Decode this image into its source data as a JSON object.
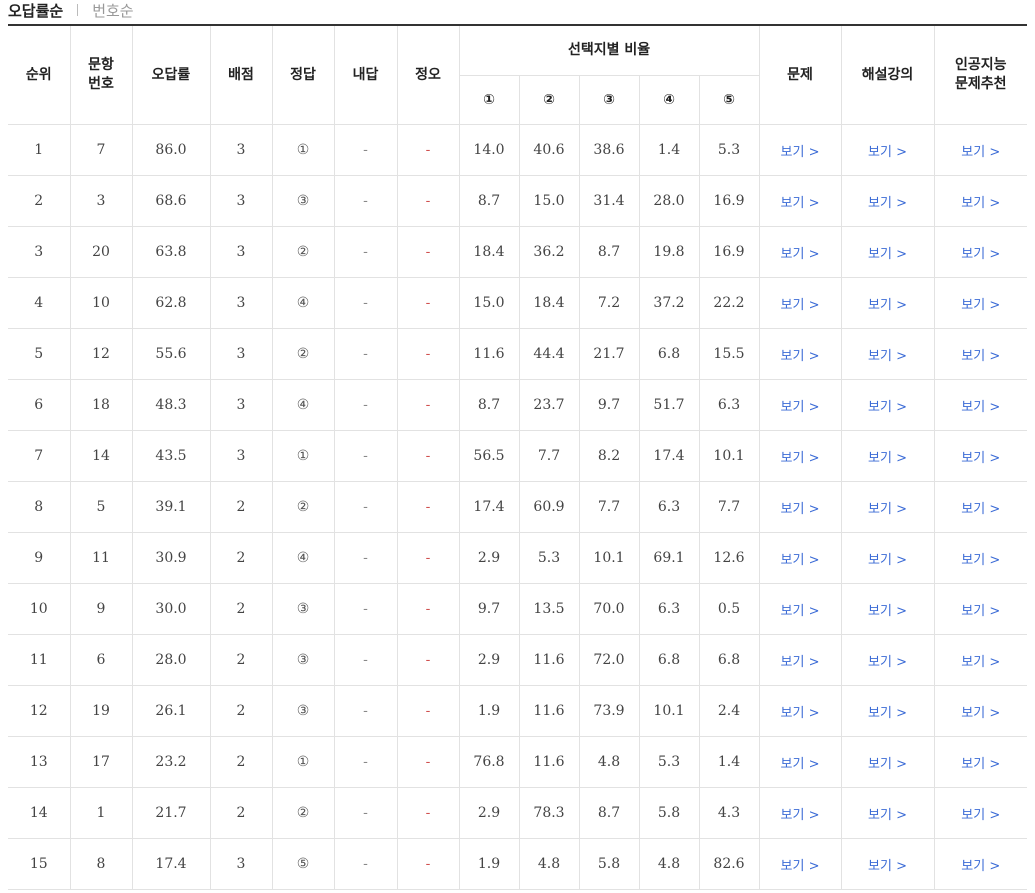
{
  "sort": {
    "active": "오답률순",
    "inactive": "번호순"
  },
  "headers": {
    "rank": "순위",
    "qnum": "문항\n번호",
    "wrong_rate": "오답률",
    "points": "배점",
    "answer": "정답",
    "mine": "내답",
    "result": "정오",
    "choice_group": "선택지별 비율",
    "choices": [
      "①",
      "②",
      "③",
      "④",
      "⑤"
    ],
    "problem": "문제",
    "lecture": "해설강의",
    "ai": "인공지능\n문제추천"
  },
  "link_label": "보기 >",
  "dash": "-",
  "rows": [
    {
      "rank": "1",
      "q": "7",
      "rate": "86.0",
      "pts": "3",
      "ans": "①",
      "mine": "-",
      "ox": "-",
      "c": [
        "14.0",
        "40.6",
        "38.6",
        "1.4",
        "5.3"
      ]
    },
    {
      "rank": "2",
      "q": "3",
      "rate": "68.6",
      "pts": "3",
      "ans": "③",
      "mine": "-",
      "ox": "-",
      "c": [
        "8.7",
        "15.0",
        "31.4",
        "28.0",
        "16.9"
      ]
    },
    {
      "rank": "3",
      "q": "20",
      "rate": "63.8",
      "pts": "3",
      "ans": "②",
      "mine": "-",
      "ox": "-",
      "c": [
        "18.4",
        "36.2",
        "8.7",
        "19.8",
        "16.9"
      ]
    },
    {
      "rank": "4",
      "q": "10",
      "rate": "62.8",
      "pts": "3",
      "ans": "④",
      "mine": "-",
      "ox": "-",
      "c": [
        "15.0",
        "18.4",
        "7.2",
        "37.2",
        "22.2"
      ]
    },
    {
      "rank": "5",
      "q": "12",
      "rate": "55.6",
      "pts": "3",
      "ans": "②",
      "mine": "-",
      "ox": "-",
      "c": [
        "11.6",
        "44.4",
        "21.7",
        "6.8",
        "15.5"
      ]
    },
    {
      "rank": "6",
      "q": "18",
      "rate": "48.3",
      "pts": "3",
      "ans": "④",
      "mine": "-",
      "ox": "-",
      "c": [
        "8.7",
        "23.7",
        "9.7",
        "51.7",
        "6.3"
      ]
    },
    {
      "rank": "7",
      "q": "14",
      "rate": "43.5",
      "pts": "3",
      "ans": "①",
      "mine": "-",
      "ox": "-",
      "c": [
        "56.5",
        "7.7",
        "8.2",
        "17.4",
        "10.1"
      ]
    },
    {
      "rank": "8",
      "q": "5",
      "rate": "39.1",
      "pts": "2",
      "ans": "②",
      "mine": "-",
      "ox": "-",
      "c": [
        "17.4",
        "60.9",
        "7.7",
        "6.3",
        "7.7"
      ]
    },
    {
      "rank": "9",
      "q": "11",
      "rate": "30.9",
      "pts": "2",
      "ans": "④",
      "mine": "-",
      "ox": "-",
      "c": [
        "2.9",
        "5.3",
        "10.1",
        "69.1",
        "12.6"
      ]
    },
    {
      "rank": "10",
      "q": "9",
      "rate": "30.0",
      "pts": "2",
      "ans": "③",
      "mine": "-",
      "ox": "-",
      "c": [
        "9.7",
        "13.5",
        "70.0",
        "6.3",
        "0.5"
      ]
    },
    {
      "rank": "11",
      "q": "6",
      "rate": "28.0",
      "pts": "2",
      "ans": "③",
      "mine": "-",
      "ox": "-",
      "c": [
        "2.9",
        "11.6",
        "72.0",
        "6.8",
        "6.8"
      ]
    },
    {
      "rank": "12",
      "q": "19",
      "rate": "26.1",
      "pts": "2",
      "ans": "③",
      "mine": "-",
      "ox": "-",
      "c": [
        "1.9",
        "11.6",
        "73.9",
        "10.1",
        "2.4"
      ]
    },
    {
      "rank": "13",
      "q": "17",
      "rate": "23.2",
      "pts": "2",
      "ans": "①",
      "mine": "-",
      "ox": "-",
      "c": [
        "76.8",
        "11.6",
        "4.8",
        "5.3",
        "1.4"
      ]
    },
    {
      "rank": "14",
      "q": "1",
      "rate": "21.7",
      "pts": "2",
      "ans": "②",
      "mine": "-",
      "ox": "-",
      "c": [
        "2.9",
        "78.3",
        "8.7",
        "5.8",
        "4.3"
      ]
    },
    {
      "rank": "15",
      "q": "8",
      "rate": "17.4",
      "pts": "3",
      "ans": "⑤",
      "mine": "-",
      "ox": "-",
      "c": [
        "1.9",
        "4.8",
        "5.8",
        "4.8",
        "82.6"
      ]
    }
  ],
  "colors": {
    "link": "#3b6bd6",
    "wrong_dash": "#d0504f",
    "border": "#e2e2e2",
    "top_border": "#333333"
  }
}
